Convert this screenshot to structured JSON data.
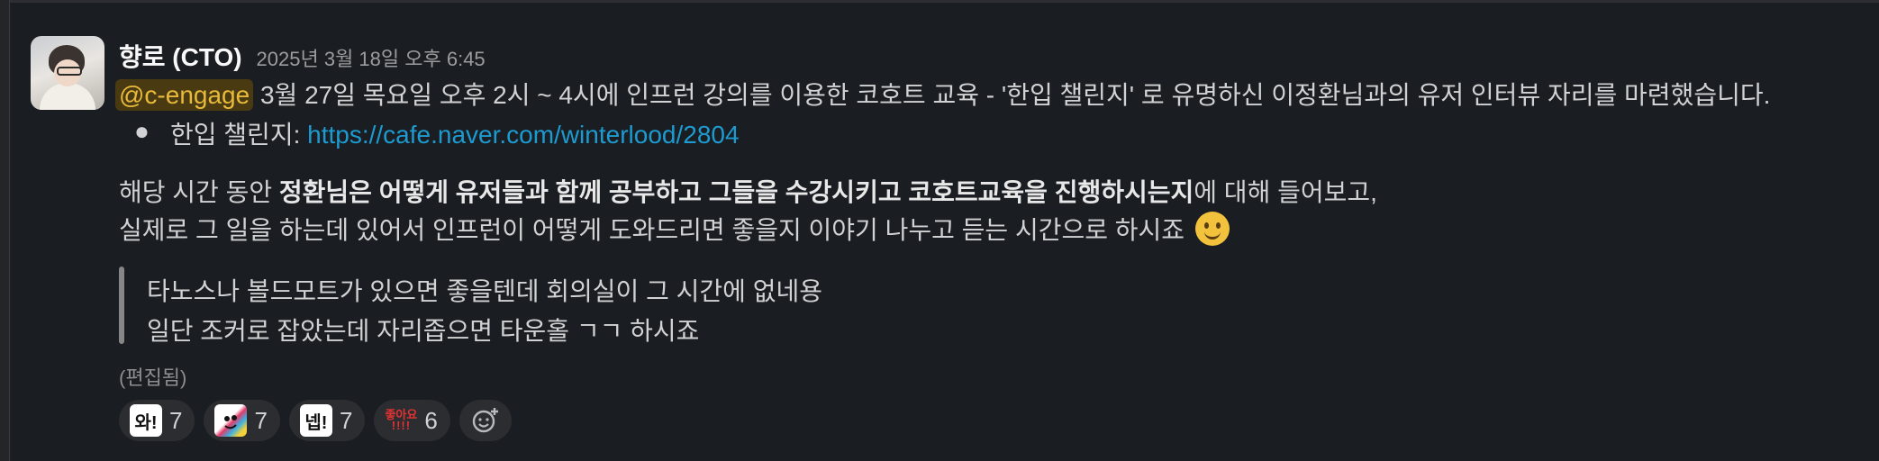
{
  "message": {
    "author": "향로 (CTO)",
    "timestamp": "2025년 3월 18일 오후 6:45",
    "mention": "@c-engage",
    "line1": " 3월 27일 목요일 오후 2시 ~ 4시에 인프런 강의를 이용한 코호트 교육 - '한입 챌린지' 로 유명하신 이정환님과의 유저 인터뷰 자리를 마련했습니다.",
    "bullet_label": "한입 챌린지: ",
    "bullet_link": "https://cafe.naver.com/winterlood/2804",
    "para1_pre": "해당 시간 동안 ",
    "para1_bold": "정환님은 어떻게 유저들과 함께 공부하고 그들을 수강시키고 코호트교육을 진행하시는지",
    "para1_post": "에 대해 들어보고,",
    "para2": "실제로 그 일을 하는데 있어서 인프런이 어떻게 도와드리면 좋을지 이야기 나누고 듣는 시간으로 하시죠 ",
    "quote_line1": "타노스나 볼드모트가 있으면 좋을텐데 회의실이 그 시간에 없네용",
    "quote_line2": "일단 조커로 잡았는데 자리좁으면 타운홀 ㄱㄱ 하시죠",
    "edited": "(편집됨)"
  },
  "reactions": [
    {
      "emoji_text": "와!",
      "emoji_name": "wow-text-emoji",
      "count": "7"
    },
    {
      "emoji_text": "",
      "emoji_name": "party-face-emoji",
      "count": "7"
    },
    {
      "emoji_text": "넵!",
      "emoji_name": "yes-text-emoji",
      "count": "7"
    },
    {
      "emoji_text": "좋아요",
      "emoji_name": "like-text-emoji",
      "count": "6"
    }
  ],
  "colors": {
    "background": "#1a1d21",
    "mention_bg": "#4a3a12",
    "mention_fg": "#e8b93a",
    "link": "#1d9bd1",
    "reaction_bg": "#2b2d31"
  }
}
